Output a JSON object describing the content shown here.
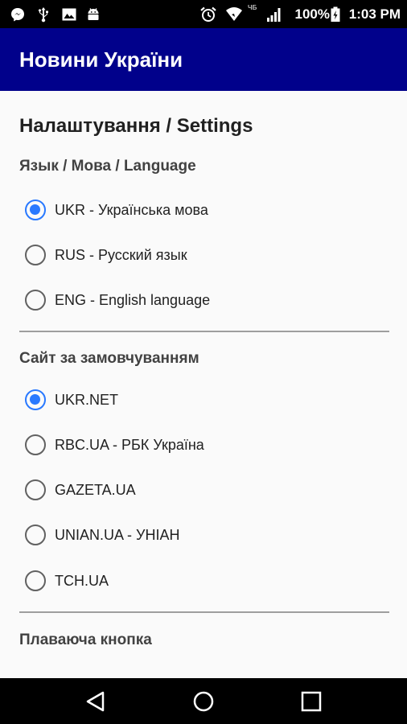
{
  "status_bar": {
    "carrier": "ЧБ",
    "battery": "100%",
    "time": "1:03 PM",
    "icons": [
      "messenger-icon",
      "usb-icon",
      "image-icon",
      "android-icon",
      "alarm-icon",
      "wifi-icon",
      "signal-icon",
      "battery-icon"
    ]
  },
  "app_bar": {
    "title": "Новини України"
  },
  "settings": {
    "title": "Налаштування / Settings",
    "language": {
      "title": "Язык / Мова / Language",
      "options": [
        {
          "label": "UKR - Українська мова",
          "selected": true
        },
        {
          "label": "RUS - Русский язык",
          "selected": false
        },
        {
          "label": "ENG - English language",
          "selected": false
        }
      ]
    },
    "default_site": {
      "title": "Сайт за замовчуванням",
      "options": [
        {
          "label": "UKR.NET",
          "selected": true
        },
        {
          "label": "RBC.UA - РБК Україна",
          "selected": false
        },
        {
          "label": "GAZETA.UA",
          "selected": false
        },
        {
          "label": "UNIAN.UA - УНІАН",
          "selected": false
        },
        {
          "label": "TCH.UA",
          "selected": false
        }
      ]
    },
    "floating_button": {
      "title": "Плаваюча кнопка"
    }
  },
  "colors": {
    "app_bar": "#01018b",
    "accent": "#2979ff"
  },
  "nav_bar": {
    "icons": [
      "back-icon",
      "home-icon",
      "recents-icon"
    ]
  }
}
